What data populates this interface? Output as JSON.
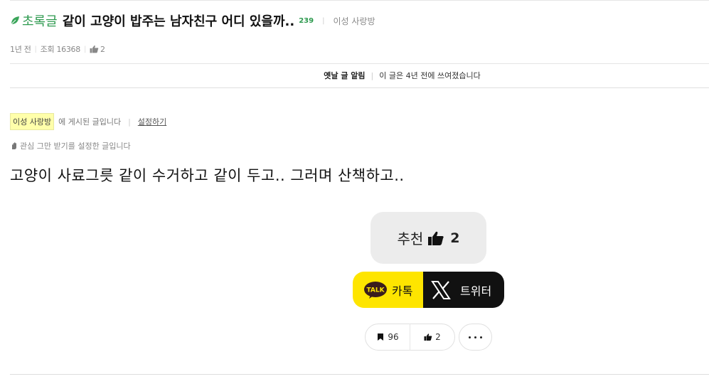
{
  "post": {
    "category_label": "초록글",
    "title": "같이 고양이 밥주는 남자친구 어디 있을까..",
    "comment_count": "239",
    "board_name": "이성 사랑방"
  },
  "meta": {
    "time": "1년 전",
    "views": "조회 16368",
    "likes": "2"
  },
  "notice": {
    "label": "옛날 글 알림",
    "text": "이 글은 4년 전에 쓰여졌습니다"
  },
  "board_info": {
    "board_tag": "이성 사랑방",
    "posted_text": "에 게시된 글입니다",
    "settings_link": "설정하기"
  },
  "interest": {
    "text": "관심 그만 받기를 설정한 글입니다"
  },
  "content": {
    "body": "고양이 사료그릇 같이 수거하고 같이 두고.. 그러며 산책하고.."
  },
  "recommend": {
    "label": "추천",
    "count": "2"
  },
  "share": {
    "kakao_badge": "TALK",
    "kakao_label": "카톡",
    "twitter_label": "트위터"
  },
  "actions": {
    "bookmark_count": "96",
    "like_count": "2"
  },
  "colors": {
    "accent_green": "#2e9a4f",
    "kakao_yellow": "#fee500",
    "board_tag_bg": "#ffffaa"
  },
  "icons": [
    "leaf-icon",
    "thumb-up-icon",
    "hand-icon",
    "kakao-talk-icon",
    "x-logo-icon",
    "bookmark-icon",
    "more-icon"
  ]
}
